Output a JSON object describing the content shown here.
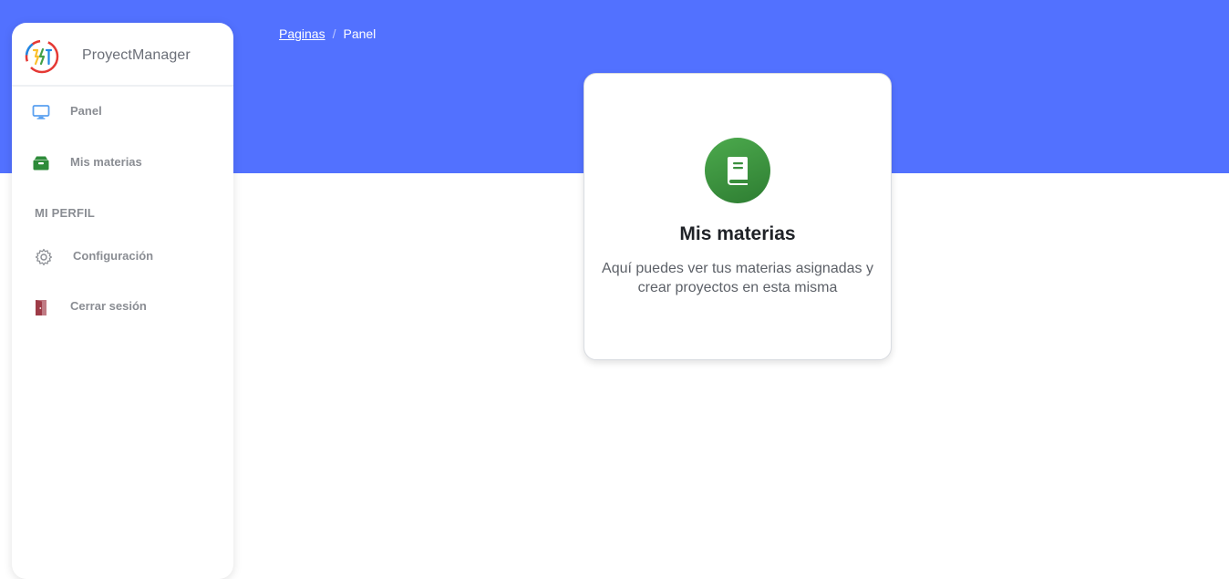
{
  "sidebar": {
    "brand_name": "ProyectManager",
    "items": [
      {
        "label": "Panel",
        "icon": "monitor-icon"
      },
      {
        "label": "Mis materias",
        "icon": "inbox-tray-icon"
      }
    ],
    "section_label": "MI PERFIL",
    "profile_items": [
      {
        "label": "Configuración",
        "icon": "gear-icon"
      },
      {
        "label": "Cerrar sesión",
        "icon": "door-icon"
      }
    ]
  },
  "breadcrumb": {
    "root": "Paginas",
    "separator": "/",
    "current": "Panel"
  },
  "card": {
    "title": "Mis materias",
    "description": "Aquí puedes ver tus materias asignadas y crear proyectos en esta misma",
    "icon": "book-icon"
  },
  "colors": {
    "header_band": "#5271ff",
    "card_icon_bg": "#3b8f3e",
    "sidebar_text": "#8a8d93"
  }
}
